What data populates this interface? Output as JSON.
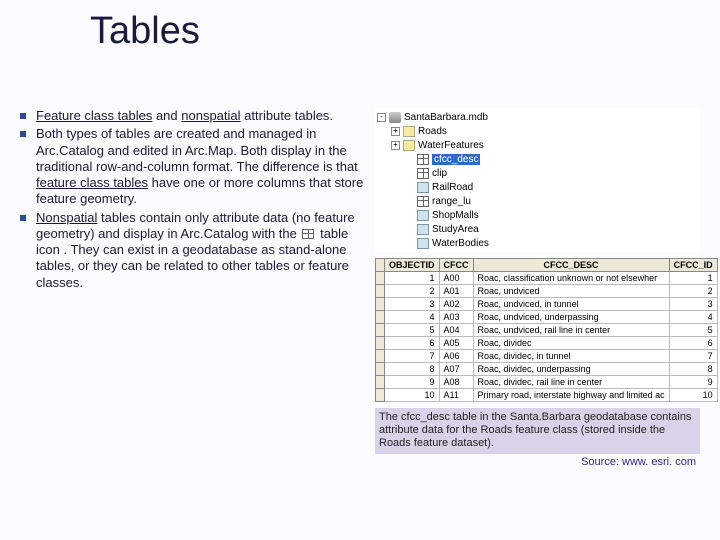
{
  "title": "Tables",
  "bullets": [
    {
      "html": "<span class='underline'>Feature class tables</span> and <span class='underline'>nonspatial</span> attribute tables."
    },
    {
      "html": "Both types of tables are created and managed in Arc.Catalog and edited in Arc.Map. Both display in the traditional row-and-column format. The difference is that <span class='underline'>feature class tables</span> have one or more columns that store feature geometry."
    },
    {
      "html": "<span class='underline'>Nonspatial</span> tables contain only attribute data (no feature geometry) and display in Arc.Catalog with the <span class='tbl-icon-inline' data-name='table-icon' data-interactable='false'></span> table icon . They can exist in a geodatabase as stand-alone tables, or they can be related to other tables or feature classes."
    }
  ],
  "tree": [
    {
      "indent": 0,
      "exp": "-",
      "icon": "mdb",
      "label": "SantaBarbara.mdb"
    },
    {
      "indent": 1,
      "exp": "+",
      "icon": "ds",
      "label": "Roads"
    },
    {
      "indent": 1,
      "exp": "+",
      "icon": "ds",
      "label": "WaterFeatures"
    },
    {
      "indent": 2,
      "exp": "",
      "icon": "table",
      "label": "cfcc_desc",
      "selected": true
    },
    {
      "indent": 2,
      "exp": "",
      "icon": "table",
      "label": "clip"
    },
    {
      "indent": 2,
      "exp": "",
      "icon": "fc",
      "label": "RailRoad"
    },
    {
      "indent": 2,
      "exp": "",
      "icon": "table",
      "label": "range_lu"
    },
    {
      "indent": 2,
      "exp": "",
      "icon": "fc",
      "label": "ShopMalls"
    },
    {
      "indent": 2,
      "exp": "",
      "icon": "fc",
      "label": "StudyArea"
    },
    {
      "indent": 2,
      "exp": "",
      "icon": "fc",
      "label": "WaterBodies"
    }
  ],
  "table": {
    "headers": [
      "OBJECTID",
      "CFCC",
      "CFCC_DESC",
      "CFCC_ID"
    ],
    "rows": [
      [
        "1",
        "A00",
        "Roac, classification unknown or not elsewher",
        "1"
      ],
      [
        "2",
        "A01",
        "Roac, undviced",
        "2"
      ],
      [
        "3",
        "A02",
        "Roac, undviced, in tunnel",
        "3"
      ],
      [
        "4",
        "A03",
        "Roac, undviced, underpassing",
        "4"
      ],
      [
        "5",
        "A04",
        "Roac, undviced, rail line in center",
        "5"
      ],
      [
        "6",
        "A05",
        "Roac, dividec",
        "6"
      ],
      [
        "7",
        "A06",
        "Roac, dividec, in tunnel",
        "7"
      ],
      [
        "8",
        "A07",
        "Roac, dividec, underpassing",
        "8"
      ],
      [
        "9",
        "A08",
        "Roac, dividec, rail line in center",
        "9"
      ],
      [
        "10",
        "A11",
        "Primary road, interstate highway and limited ac",
        "10"
      ]
    ]
  },
  "caption": "The cfcc_desc table in the Santa.Barbara geodatabase contains attribute data for the Roads feature class (stored inside the Roads feature dataset).",
  "source": "Source: www. esri. com"
}
